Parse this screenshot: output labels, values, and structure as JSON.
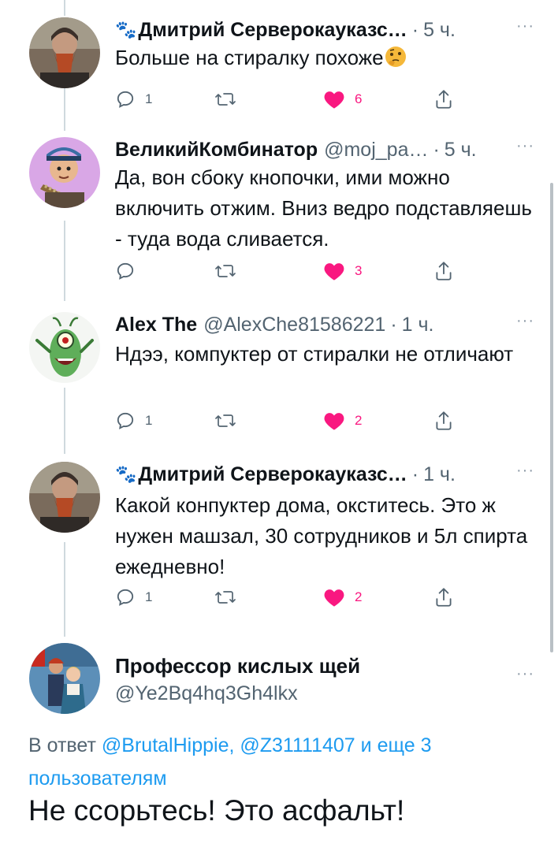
{
  "tweets": [
    {
      "name": "Дмитрий Серверокауказс…",
      "badge_icon": "paw-prints-icon",
      "handle": "",
      "time": "5 ч.",
      "text": "Больше на стиралку похоже",
      "trailing_emoji": "thinking-face-emoji",
      "replies": "1",
      "retweets": "",
      "likes": "6",
      "liked": true
    },
    {
      "name": "ВеликийКомбинатор",
      "handle": "@moj_pa…",
      "time": "5 ч.",
      "text": "Да, вон сбоку кнопочки, ими можно включить отжим. Вниз ведро подставляешь - туда вода сливается.",
      "replies": "",
      "retweets": "",
      "likes": "3",
      "liked": true
    },
    {
      "name": "Alex The",
      "handle": "@AlexChe81586221",
      "time": "1 ч.",
      "text": "Ндээ, компуктер от стиралки не отличают",
      "replies": "1",
      "retweets": "",
      "likes": "2",
      "liked": true
    },
    {
      "name": "Дмитрий Серверокауказс…",
      "badge_icon": "paw-prints-icon",
      "handle": "",
      "time": "1 ч.",
      "text": "Какой конпуктер дома, окститесь. Это ж нужен машзал, 30 сотрудников и 5л спирта ежедневно!",
      "replies": "1",
      "retweets": "",
      "likes": "2",
      "liked": true
    }
  ],
  "separator": "·",
  "more_label": "···",
  "focused": {
    "name": "Профессор кислых щей",
    "handle": "@Ye2Bq4hq3Gh4lkx",
    "reply_prefix": "В ответ",
    "mention1": "@BrutalHippie,",
    "mention2": "@Z31111407",
    "reply_suffix1": "и еще 3",
    "reply_suffix2": "пользователям",
    "text": "Не ссорьтесь! Это асфальт!"
  },
  "colors": {
    "like": "#f91880",
    "link": "#1d9bf0",
    "secondary": "#536471",
    "thread_line": "#cfd9de"
  }
}
